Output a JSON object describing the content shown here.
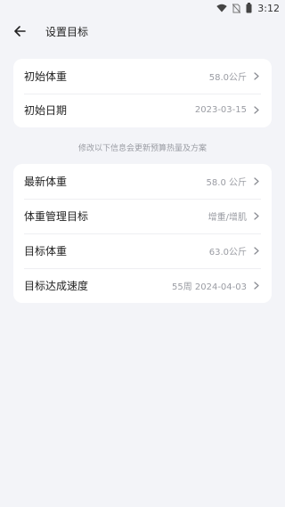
{
  "status": {
    "time": "3:12"
  },
  "appbar": {
    "title": "设置目标"
  },
  "group1": {
    "items": [
      {
        "label": "初始体重",
        "value": "58.0公斤"
      },
      {
        "label": "初始日期",
        "value": "2023-03-15"
      }
    ]
  },
  "hint": "修改以下信息会更新预算热量及方案",
  "group2": {
    "items": [
      {
        "label": "最新体重",
        "value": "58.0 公斤"
      },
      {
        "label": "体重管理目标",
        "value": "增重/增肌"
      },
      {
        "label": "目标体重",
        "value": "63.0公斤"
      },
      {
        "label": "目标达成速度",
        "value": "55周 2024-04-03"
      }
    ]
  },
  "colors": {
    "background": "#f3f4f8",
    "card": "#ffffff",
    "muted_text": "#9a9ca3"
  }
}
